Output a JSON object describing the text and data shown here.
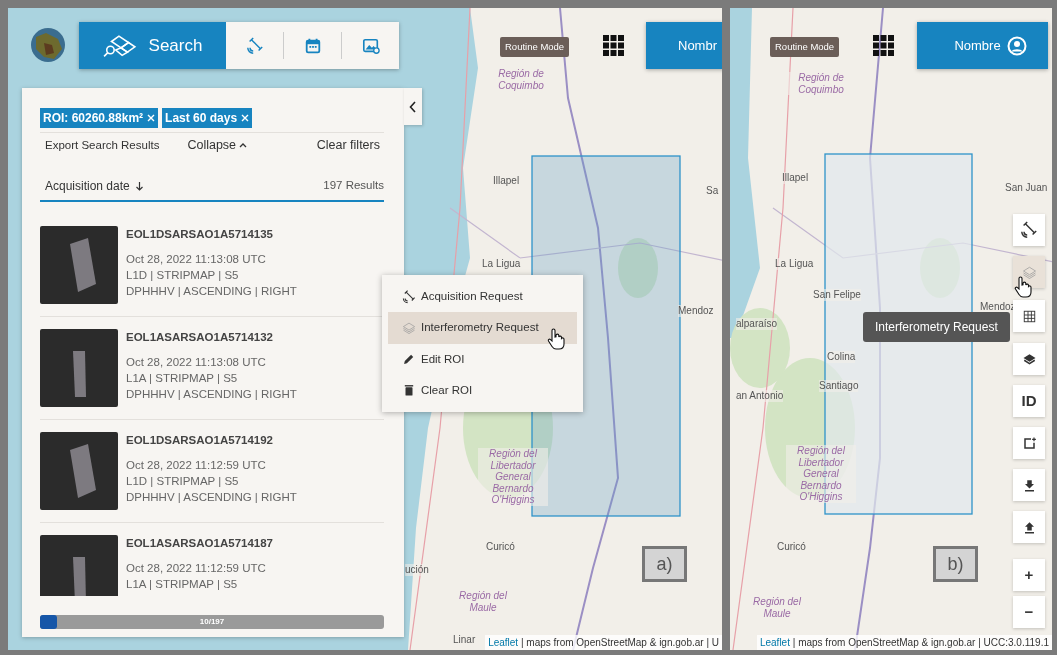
{
  "panel_a": {
    "toolbar": [
      {
        "kind": "search",
        "label": "Search",
        "selected": true
      },
      {
        "kind": "satellite",
        "selected": false
      },
      {
        "kind": "calendar",
        "selected": false
      },
      {
        "kind": "image",
        "selected": false
      }
    ],
    "mode_badge": "Routine Mode",
    "user_button": "Nombr",
    "sidebar": {
      "filters": [
        {
          "label": "ROI: 60260.88km²"
        },
        {
          "label": "Last 60 days"
        }
      ],
      "export": "Export Search Results",
      "collapse": "Collapse",
      "clear": "Clear filters",
      "sort": "Acquisition date",
      "count": "197 Results",
      "results": [
        {
          "id": "EOL1DSARSAO1A5714135",
          "date": "Oct 28, 2022 11:13:08 UTC",
          "product": "L1D | STRIPMAP | S5",
          "mode": "DPHHHV | ASCENDING | RIGHT"
        },
        {
          "id": "EOL1ASARSAO1A5714132",
          "date": "Oct 28, 2022 11:13:08 UTC",
          "product": "L1A | STRIPMAP | S5",
          "mode": "DPHHHV | ASCENDING | RIGHT"
        },
        {
          "id": "EOL1DSARSAO1A5714192",
          "date": "Oct 28, 2022 11:12:59 UTC",
          "product": "L1D | STRIPMAP | S5",
          "mode": "DPHHHV | ASCENDING | RIGHT"
        },
        {
          "id": "EOL1ASARSAO1A5714187",
          "date": "Oct 28, 2022 11:12:59 UTC",
          "product": "L1A | STRIPMAP | S5"
        }
      ],
      "progress": {
        "label": "10/197",
        "level": 0.05
      }
    },
    "context_menu": [
      {
        "kind": "satellite",
        "label": "Acquisition Request",
        "highlighted": false
      },
      {
        "kind": "layers",
        "label": "Interferometry Request",
        "highlighted": true
      },
      {
        "kind": "pencil",
        "label": "Edit ROI",
        "highlighted": false
      },
      {
        "kind": "trash",
        "label": "Clear ROI",
        "highlighted": false
      }
    ],
    "map_labels": [
      {
        "kind": "region",
        "text": "Región de Coquimbo"
      },
      {
        "kind": "city",
        "text": "Illapel"
      },
      {
        "kind": "city",
        "text": "Sa"
      },
      {
        "kind": "city",
        "text": "La Ligua"
      },
      {
        "kind": "city",
        "text": "Mendoz"
      },
      {
        "kind": "region",
        "text": "Región del Libertador General Bernardo O'Higgins"
      },
      {
        "kind": "city",
        "text": "ución"
      },
      {
        "kind": "city",
        "text": "Curicó"
      },
      {
        "kind": "region",
        "text": "Región del Maule"
      },
      {
        "kind": "city",
        "text": "Linar"
      }
    ],
    "caption": "a)",
    "attribution": {
      "link": "Leaflet",
      "text": "| maps from OpenStreetMap & ign.gob.ar | U"
    }
  },
  "panel_b": {
    "mode_badge": "Routine Mode",
    "user_button": "Nombre",
    "tools": [
      {
        "kind": "satellite",
        "highlighted": false
      },
      {
        "kind": "layers-outline",
        "highlighted": true
      },
      {
        "kind": "grid",
        "highlighted": false
      },
      {
        "kind": "layers",
        "highlighted": false
      },
      {
        "kind": "text",
        "label": "ID",
        "highlighted": false
      },
      {
        "kind": "roi-add",
        "highlighted": false
      },
      {
        "kind": "download",
        "highlighted": false
      },
      {
        "kind": "upload",
        "highlighted": false
      },
      {
        "kind": "text",
        "label": "+",
        "highlighted": false
      },
      {
        "kind": "text",
        "label": "−",
        "highlighted": false
      }
    ],
    "tooltip": "Interferometry Request",
    "map_labels": [
      {
        "kind": "region",
        "text": "Región de Coquimbo"
      },
      {
        "kind": "city",
        "text": "Illapel"
      },
      {
        "kind": "city",
        "text": "San Juan"
      },
      {
        "kind": "city",
        "text": "La Ligua"
      },
      {
        "kind": "city",
        "text": "San Felipe"
      },
      {
        "kind": "city",
        "text": "Mendoz"
      },
      {
        "kind": "city",
        "text": "alparaíso"
      },
      {
        "kind": "city",
        "text": "Colina"
      },
      {
        "kind": "city",
        "text": "Santiago"
      },
      {
        "kind": "city",
        "text": "an Antonio"
      },
      {
        "kind": "region",
        "text": "Región del Libertador General Bernardo O'Higgins"
      },
      {
        "kind": "city",
        "text": "Curicó"
      },
      {
        "kind": "region",
        "text": "Región del Maule"
      }
    ],
    "caption": "b)",
    "attribution": {
      "link": "Leaflet",
      "text": "| maps from OpenStreetMap & ign.gob.ar | UCC:3.0.119.1"
    }
  }
}
